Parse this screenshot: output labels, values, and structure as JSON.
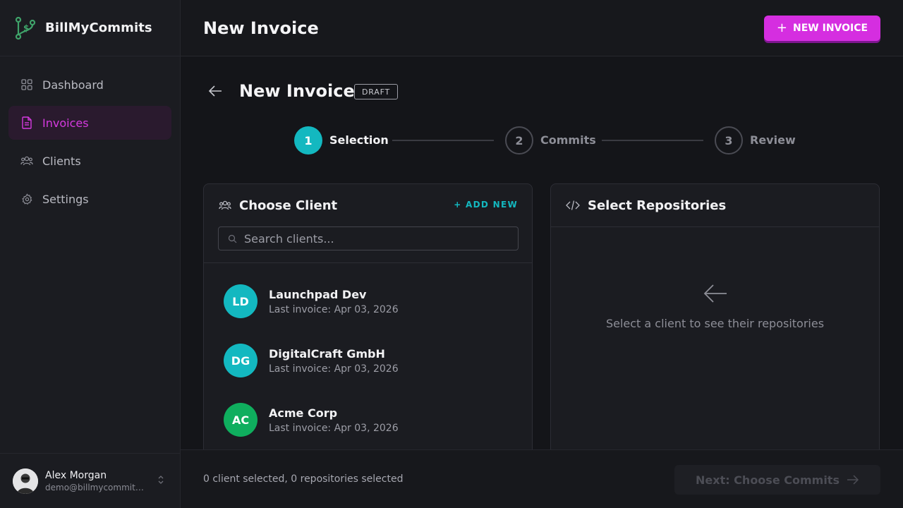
{
  "app": {
    "name": "BillMyCommits"
  },
  "sidebar": {
    "items": [
      {
        "label": "Dashboard",
        "icon": "grid-icon",
        "active": false
      },
      {
        "label": "Invoices",
        "icon": "document-icon",
        "active": true
      },
      {
        "label": "Clients",
        "icon": "users-icon",
        "active": false
      },
      {
        "label": "Settings",
        "icon": "gear-icon",
        "active": false
      }
    ]
  },
  "user": {
    "name": "Alex Morgan",
    "email": "demo@billmycommits...."
  },
  "header": {
    "title": "New Invoice",
    "new_button": "NEW INVOICE"
  },
  "invoice": {
    "title": "New Invoice",
    "status": "DRAFT"
  },
  "stepper": {
    "steps": [
      {
        "number": "1",
        "label": "Selection",
        "state": "active"
      },
      {
        "number": "2",
        "label": "Commits",
        "state": "inactive"
      },
      {
        "number": "3",
        "label": "Review",
        "state": "inactive"
      }
    ]
  },
  "client_panel": {
    "title": "Choose Client",
    "add_new": "+ ADD NEW",
    "search_placeholder": "Search clients...",
    "clients": [
      {
        "initials": "LD",
        "name": "Launchpad Dev",
        "last_invoice": "Last invoice: Apr 03, 2026",
        "color": "#13b8c0"
      },
      {
        "initials": "DG",
        "name": "DigitalCraft GmbH",
        "last_invoice": "Last invoice: Apr 03, 2026",
        "color": "#13b8c0"
      },
      {
        "initials": "AC",
        "name": "Acme Corp",
        "last_invoice": "Last invoice: Apr 03, 2026",
        "color": "#0fae5e"
      }
    ]
  },
  "repo_panel": {
    "title": "Select Repositories",
    "empty_text": "Select a client to see their repositories"
  },
  "footer": {
    "status": "0 client selected, 0 repositories selected",
    "next_button": "Next: Choose Commits"
  },
  "colors": {
    "accent": "#d52ee0",
    "teal": "#13b8c0",
    "green": "#0fae5e"
  }
}
